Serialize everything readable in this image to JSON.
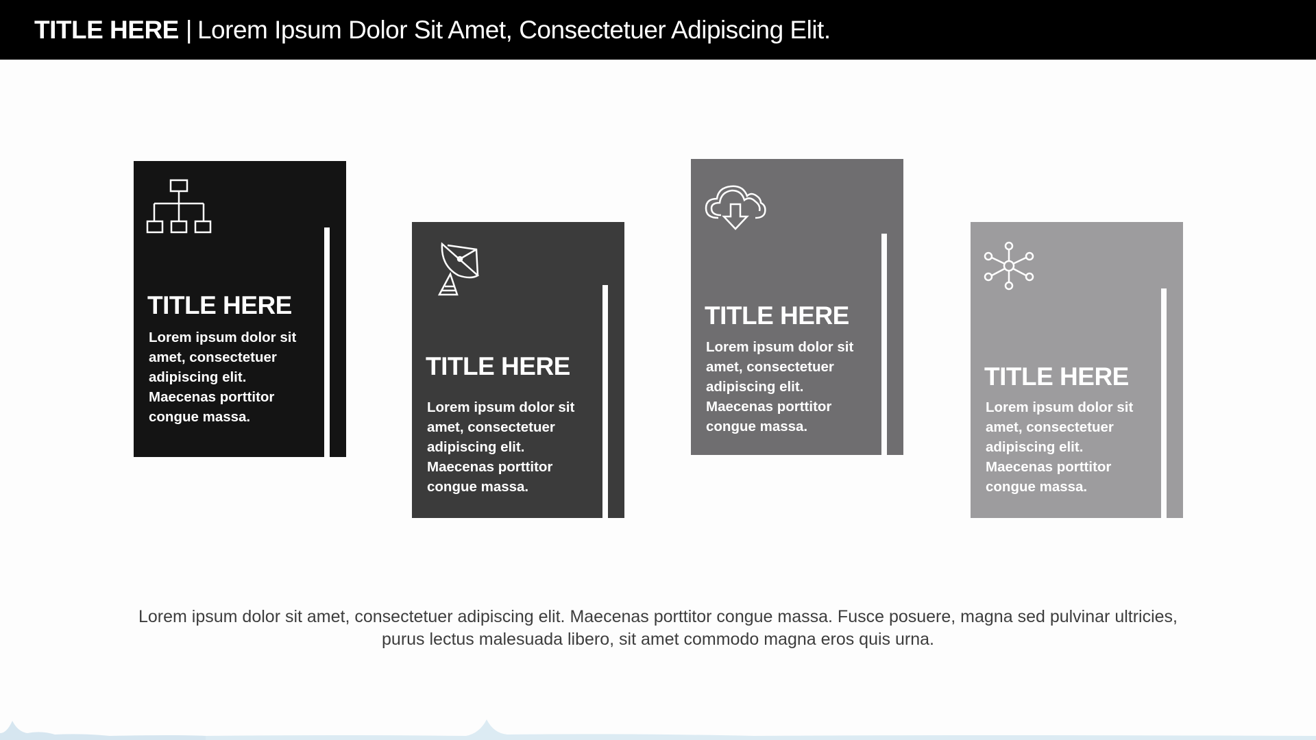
{
  "header": {
    "title_bold": "TITLE HERE",
    "separator": "|",
    "subtitle": "Lorem Ipsum Dolor Sit Amet, Consectetuer Adipiscing Elit."
  },
  "cards": [
    {
      "icon": "hierarchy-icon",
      "color": "#141414",
      "title": "TITLE HERE",
      "body": "Lorem ipsum dolor sit amet, consectetuer adipiscing elit. Maecenas porttitor congue massa."
    },
    {
      "icon": "satellite-dish-icon",
      "color": "#3b3b3b",
      "title": "TITLE HERE",
      "body": "Lorem ipsum dolor sit amet, consectetuer adipiscing elit. Maecenas porttitor congue massa."
    },
    {
      "icon": "cloud-download-icon",
      "color": "#6f6e70",
      "title": "TITLE HERE",
      "body": "Lorem ipsum dolor sit amet, consectetuer adipiscing elit. Maecenas porttitor congue massa."
    },
    {
      "icon": "network-nodes-icon",
      "color": "#9d9c9e",
      "title": "TITLE HERE",
      "body": "Lorem ipsum dolor sit amet, consectetuer adipiscing elit. Maecenas porttitor congue massa."
    }
  ],
  "footer": {
    "text": "Lorem ipsum dolor sit amet, consectetuer adipiscing elit. Maecenas porttitor congue massa. Fusce posuere, magna sed pulvinar ultricies, purus lectus malesuada libero, sit amet commodo magna eros quis urna."
  }
}
